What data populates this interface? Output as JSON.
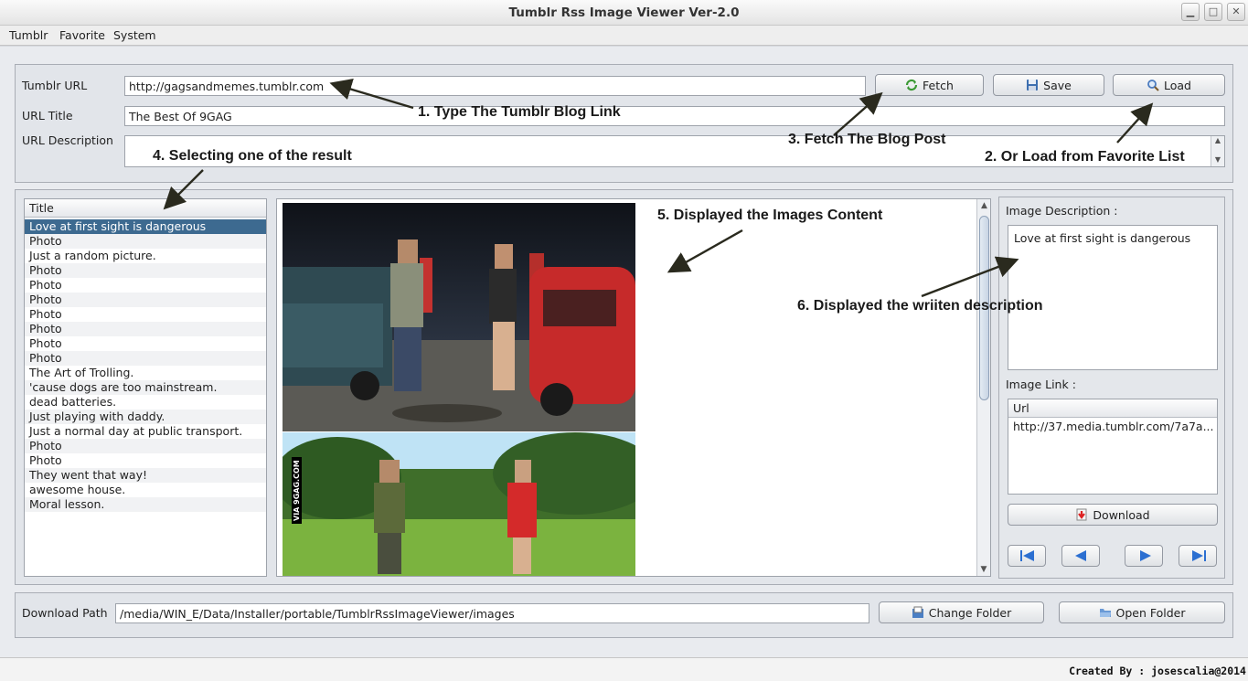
{
  "window": {
    "title": "Tumblr Rss Image Viewer Ver-2.0"
  },
  "menu": [
    "Tumblr",
    "Favorite",
    "System"
  ],
  "top": {
    "url_label": "Tumblr URL",
    "url_value": "http://gagsandmemes.tumblr.com",
    "title_label": "URL Title",
    "title_value": "The Best Of 9GAG",
    "desc_label": "URL Description",
    "fetch_label": "Fetch",
    "save_label": "Save",
    "load_label": "Load"
  },
  "list": {
    "header": "Title",
    "items": [
      "Love at first sight is dangerous",
      "Photo",
      "Just a random picture.",
      "Photo",
      "Photo",
      "Photo",
      "Photo",
      "Photo",
      "Photo",
      "Photo",
      "The Art of Trolling.",
      "'cause dogs are too mainstream.",
      "dead batteries.",
      "Just playing with daddy.",
      "Just a normal day at public transport.",
      "Photo",
      "Photo",
      "They went that way!",
      "awesome house.",
      "Moral lesson."
    ],
    "selected_index": 0
  },
  "right": {
    "desc_label": "Image Description :",
    "desc_value": "Love at first sight is dangerous",
    "link_label": "Image Link :",
    "link_header": "Url",
    "link_value": "http://37.media.tumblr.com/7a7a...",
    "download_label": "Download"
  },
  "bottom": {
    "path_label": "Download Path",
    "path_value": "/media/WIN_E/Data/Installer/portable/TumblrRssImageViewer/images",
    "change_label": "Change Folder",
    "open_label": "Open Folder"
  },
  "annotations": {
    "a1": "1. Type The Tumblr Blog Link",
    "a2": "2. Or Load from Favorite List",
    "a3": "3. Fetch The Blog Post",
    "a4": "4. Selecting one of the result",
    "a5": "5. Displayed the Images Content",
    "a6": "6. Displayed the wriiten description"
  },
  "image_watermark": "VIA 9GAG.COM",
  "footer": {
    "credit": "Created By : josescalia@2014"
  },
  "colors": {
    "selection": "#3d6a90",
    "arrow": "#2a2a1e"
  }
}
